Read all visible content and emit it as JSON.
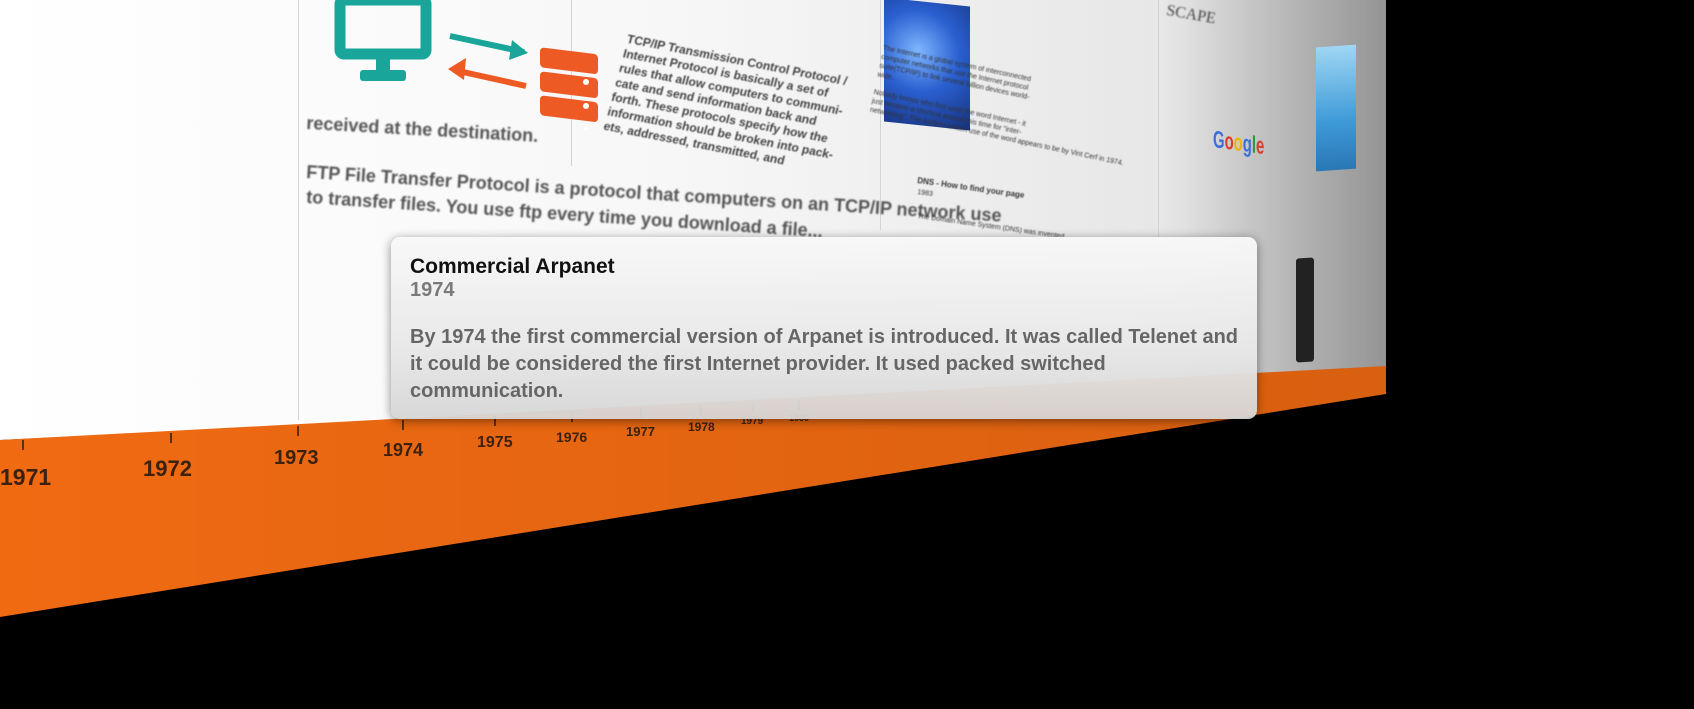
{
  "background": {
    "ftp_tail": "received at the destination.",
    "ftp_heading": "FTP File Transfer Protocol is a protocol that computers on an TCP/IP network use",
    "ftp_line2": "to transfer files. You use ftp every time you download a file...",
    "tcpip_text": "TCP/IP Transmission Control Protocol /\nInternet Protocol is basically a set of\nrules that allow computers to communi-\ncate and send information back and\nforth. These protocols specify how the\ninformation should be broken into pack-\nets, addressed, transmitted, and",
    "internet_text": "The Internet is a global system of interconnected\ncomputer networks that use the Internet protocol\nsuite(TCP/IP) to link several billion devices world-\nwide.\n\nNobody knows who first used the word Internet - it\njust became a shortcut around this time for \"inter-\nnetworking\". The earliest written use of the word appears to be by Vint Cerf in 1974.",
    "dns_title": "DNS - How to find your page",
    "dns_year": "1983",
    "dns_text": "The Domain Name System (DNS) was invented...",
    "netscape": "SCAPE",
    "google_logo": "Google"
  },
  "timeline": {
    "years": [
      "1971",
      "1972",
      "1973",
      "1974",
      "1975",
      "1976",
      "1977",
      "1978",
      "1979",
      "1980"
    ]
  },
  "tooltip": {
    "title": "Commercial Arpanet",
    "year": "1974",
    "body": "By 1974 the first commercial version of Arpanet is introduced. It was called Telenet and it could be considered the first Internet provider. It used packed switched communication."
  },
  "icons": {
    "computer": "monitor-icon",
    "transfer": "arrows-icon",
    "server": "server-icon"
  },
  "colors": {
    "band": "#f06a12",
    "teal": "#1aa59a",
    "orange": "#ee5a24"
  }
}
